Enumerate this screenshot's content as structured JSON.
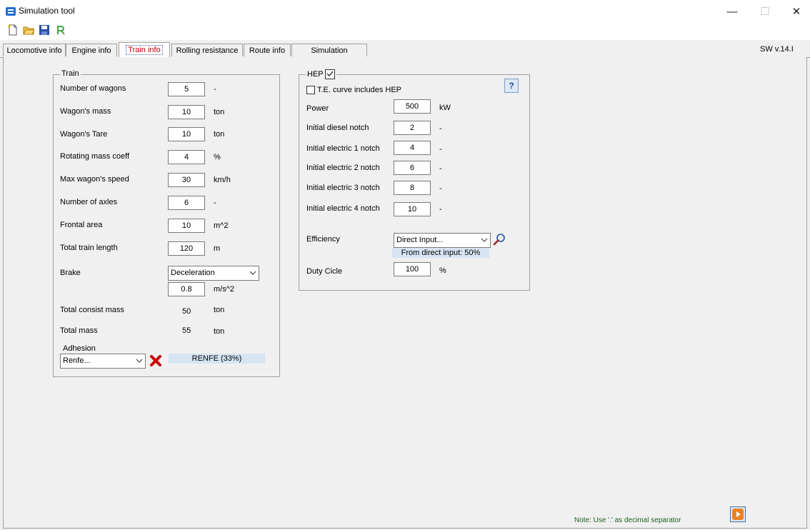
{
  "window": {
    "title": "Simulation tool",
    "minimize_glyph": "—",
    "maximize_glyph": "☐",
    "close_glyph": "✕"
  },
  "toolbar": {
    "icons": [
      "new-file-icon",
      "open-folder-icon",
      "save-icon",
      "export-icon"
    ]
  },
  "tabs": [
    {
      "label": "Locomotive info"
    },
    {
      "label": "Engine info"
    },
    {
      "label": "Train info",
      "active": true
    },
    {
      "label": "Rolling resistance"
    },
    {
      "label": "Route info"
    },
    {
      "label": "Simulation"
    }
  ],
  "version": "SW v.14.I",
  "train": {
    "title": "Train",
    "fields": [
      {
        "label": "Number of wagons",
        "value": "5",
        "unit": "-"
      },
      {
        "label": "Wagon's mass",
        "value": "10",
        "unit": "ton"
      },
      {
        "label": "Wagon's Tare",
        "value": "10",
        "unit": "ton"
      },
      {
        "label": "Rotating mass coeff",
        "value": "4",
        "unit": "%"
      },
      {
        "label": "Max wagon's speed",
        "value": "30",
        "unit": "km/h"
      },
      {
        "label": "Number of axles",
        "value": "6",
        "unit": "-"
      },
      {
        "label": "Frontal area",
        "value": "10",
        "unit": "m^2"
      },
      {
        "label": "Total train length",
        "value": "120",
        "unit": "m"
      }
    ],
    "brake": {
      "label": "Brake",
      "mode": "Deceleration",
      "value": "0.8",
      "unit": "m/s^2"
    },
    "total_consist_mass": {
      "label": "Total consist mass",
      "value": "50",
      "unit": "ton"
    },
    "total_mass": {
      "label": "Total mass",
      "value": "55",
      "unit": "ton"
    },
    "adhesion": {
      "label": "Adhesion",
      "selected": "Renfe...",
      "info": "RENFE  (33%)",
      "delete_color": "#cc0000"
    }
  },
  "hep": {
    "title": "HEP",
    "enabled": true,
    "te_curve_label": "T.E. curve includes HEP",
    "te_curve_checked": false,
    "help_label": "?",
    "fields": [
      {
        "label": "Power",
        "value": "500",
        "unit": "kW"
      },
      {
        "label": "Initial diesel notch",
        "value": "2",
        "unit": "-"
      },
      {
        "label": "Initial electric 1 notch",
        "value": "4",
        "unit": "-"
      },
      {
        "label": "Initial electric 2 notch",
        "value": "6",
        "unit": "-"
      },
      {
        "label": "Initial electric 3 notch",
        "value": "8",
        "unit": "-"
      },
      {
        "label": "Initial electric 4 notch",
        "value": "10",
        "unit": "-"
      }
    ],
    "efficiency": {
      "label": "Efficiency",
      "selected": "Direct Input...",
      "info": "From direct input: 50%"
    },
    "duty_cycle": {
      "label": "Duty Cicle",
      "value": "100",
      "unit": "%"
    }
  },
  "footer": {
    "note": "Note: Use '.' as decimal separator"
  },
  "colors": {
    "accent": "#1e6fd9",
    "active_tab_text": "#c00000",
    "info_bar": "#d6e4f4",
    "run_button": "#f08020"
  }
}
